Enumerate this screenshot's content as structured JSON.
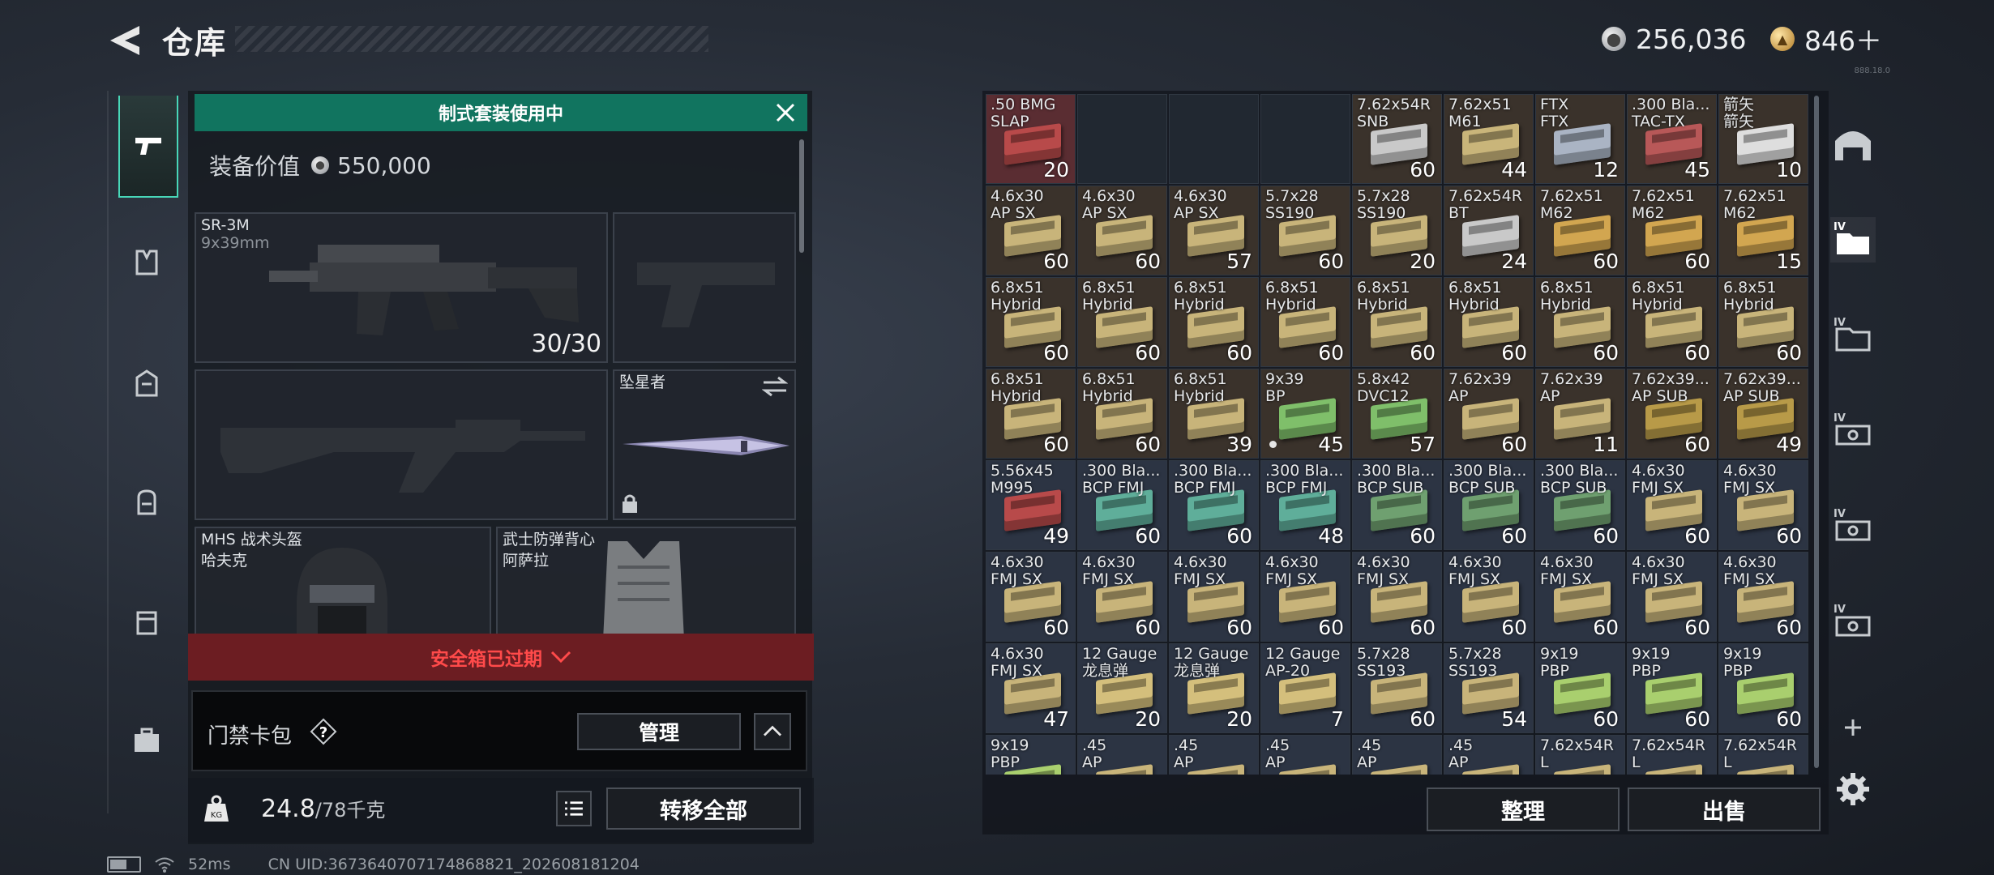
{
  "header": {
    "title": "仓库",
    "currency_silver": "256,036",
    "currency_gold": "846＋",
    "version": "888.18.0"
  },
  "loadout": {
    "banner": "制式套装使用中",
    "value_label": "装备价值",
    "value": "550,000",
    "primary": {
      "name": "SR-3M",
      "caliber": "9x39mm",
      "ammo": "30/30"
    },
    "melee": {
      "name": "坠星者"
    },
    "helmet": {
      "line1": "MHS 战术头盔",
      "line2": "哈夫克"
    },
    "vest": {
      "line1": "武士防弹背心",
      "line2": "阿萨拉"
    },
    "expired": "安全箱已过期",
    "keybag": "门禁卡包",
    "manage": "管理",
    "weight": "24.8",
    "weight_cap": "/78千克",
    "transfer_all": "转移全部"
  },
  "storage": {
    "cells": [
      {
        "name": ".50 BMG\nSLAP",
        "count": "20",
        "bg": "red",
        "box": "#b84a4a"
      },
      {
        "name": "",
        "count": "",
        "bg": "empty"
      },
      {
        "name": "",
        "count": "",
        "bg": "empty"
      },
      {
        "name": "",
        "count": "",
        "bg": "empty"
      },
      {
        "name": "7.62x54R\nSNB",
        "count": "60",
        "bg": "brown",
        "box": "#c9c9c9"
      },
      {
        "name": "7.62x51\nM61",
        "count": "44",
        "bg": "brown",
        "box": "#c9b57a"
      },
      {
        "name": "FTX\nFTX",
        "count": "12",
        "bg": "brown",
        "box": "#aab4c4"
      },
      {
        "name": ".300 Bla...\nTAC-TX",
        "count": "45",
        "bg": "brown",
        "box": "#b85858"
      },
      {
        "name": "箭矢\n箭矢",
        "count": "10",
        "bg": "brown",
        "box": "#dedede"
      },
      {
        "name": "4.6x30\nAP SX",
        "count": "60",
        "bg": "brown",
        "box": "#c8b47a"
      },
      {
        "name": "4.6x30\nAP SX",
        "count": "60",
        "bg": "brown",
        "box": "#c8b47a"
      },
      {
        "name": "4.6x30\nAP SX",
        "count": "57",
        "bg": "brown",
        "box": "#c8b47a"
      },
      {
        "name": "5.7x28\nSS190",
        "count": "60",
        "bg": "brown",
        "box": "#c8b47a"
      },
      {
        "name": "5.7x28\nSS190",
        "count": "20",
        "bg": "brown",
        "box": "#c8b47a"
      },
      {
        "name": "7.62x54R\nBT",
        "count": "24",
        "bg": "brown",
        "box": "#c9c9c9"
      },
      {
        "name": "7.62x51\nM62",
        "count": "60",
        "bg": "brown",
        "box": "#d2a650"
      },
      {
        "name": "7.62x51\nM62",
        "count": "60",
        "bg": "brown",
        "box": "#d2a650"
      },
      {
        "name": "7.62x51\nM62",
        "count": "15",
        "bg": "brown",
        "box": "#d2a650"
      },
      {
        "name": "6.8x51\nHybrid",
        "count": "60",
        "bg": "brown",
        "box": "#c8b47a"
      },
      {
        "name": "6.8x51\nHybrid",
        "count": "60",
        "bg": "brown",
        "box": "#c8b47a"
      },
      {
        "name": "6.8x51\nHybrid",
        "count": "60",
        "bg": "brown",
        "box": "#c8b47a"
      },
      {
        "name": "6.8x51\nHybrid",
        "count": "60",
        "bg": "brown",
        "box": "#c8b47a"
      },
      {
        "name": "6.8x51\nHybrid",
        "count": "60",
        "bg": "brown",
        "box": "#c8b47a"
      },
      {
        "name": "6.8x51\nHybrid",
        "count": "60",
        "bg": "brown",
        "box": "#c8b47a"
      },
      {
        "name": "6.8x51\nHybrid",
        "count": "60",
        "bg": "brown",
        "box": "#c8b47a"
      },
      {
        "name": "6.8x51\nHybrid",
        "count": "60",
        "bg": "brown",
        "box": "#c8b47a"
      },
      {
        "name": "6.8x51\nHybrid",
        "count": "60",
        "bg": "brown",
        "box": "#c8b47a"
      },
      {
        "name": "6.8x51\nHybrid",
        "count": "60",
        "bg": "brown",
        "box": "#c8b47a"
      },
      {
        "name": "6.8x51\nHybrid",
        "count": "60",
        "bg": "brown",
        "box": "#c8b47a"
      },
      {
        "name": "6.8x51\nHybrid",
        "count": "39",
        "bg": "brown",
        "box": "#c8b47a"
      },
      {
        "name": "9x39\nBP",
        "count": "45",
        "bg": "brown",
        "box": "#7fbf6a",
        "dot": true
      },
      {
        "name": "5.8x42\nDVC12",
        "count": "57",
        "bg": "brown",
        "box": "#7fbf6a"
      },
      {
        "name": "7.62x39\nAP",
        "count": "60",
        "bg": "brown",
        "box": "#c8b47a"
      },
      {
        "name": "7.62x39\nAP",
        "count": "11",
        "bg": "brown",
        "box": "#c8b47a"
      },
      {
        "name": "7.62x39...\nAP SUB",
        "count": "60",
        "bg": "brown",
        "box": "#b89a48"
      },
      {
        "name": "7.62x39...\nAP SUB",
        "count": "49",
        "bg": "brown",
        "box": "#b89a48"
      },
      {
        "name": "5.56x45\nM995",
        "count": "49",
        "bg": "blue",
        "box": "#b84a4a"
      },
      {
        "name": ".300 Bla...\nBCP FMJ",
        "count": "60",
        "bg": "blue",
        "box": "#5fae9a"
      },
      {
        "name": ".300 Bla...\nBCP FMJ",
        "count": "60",
        "bg": "blue",
        "box": "#5fae9a"
      },
      {
        "name": ".300 Bla...\nBCP FMJ",
        "count": "48",
        "bg": "blue",
        "box": "#5fae9a"
      },
      {
        "name": ".300 Bla...\nBCP SUB",
        "count": "60",
        "bg": "blue",
        "box": "#6fa070"
      },
      {
        "name": ".300 Bla...\nBCP SUB",
        "count": "60",
        "bg": "blue",
        "box": "#6fa070"
      },
      {
        "name": ".300 Bla...\nBCP SUB",
        "count": "60",
        "bg": "blue",
        "box": "#6fa070"
      },
      {
        "name": "4.6x30\nFMJ SX",
        "count": "60",
        "bg": "blue",
        "box": "#c8b47a"
      },
      {
        "name": "4.6x30\nFMJ SX",
        "count": "60",
        "bg": "blue",
        "box": "#c8b47a"
      },
      {
        "name": "4.6x30\nFMJ SX",
        "count": "60",
        "bg": "blue",
        "box": "#c8b47a"
      },
      {
        "name": "4.6x30\nFMJ SX",
        "count": "60",
        "bg": "blue",
        "box": "#c8b47a"
      },
      {
        "name": "4.6x30\nFMJ SX",
        "count": "60",
        "bg": "blue",
        "box": "#c8b47a"
      },
      {
        "name": "4.6x30\nFMJ SX",
        "count": "60",
        "bg": "blue",
        "box": "#c8b47a"
      },
      {
        "name": "4.6x30\nFMJ SX",
        "count": "60",
        "bg": "blue",
        "box": "#c8b47a"
      },
      {
        "name": "4.6x30\nFMJ SX",
        "count": "60",
        "bg": "blue",
        "box": "#c8b47a"
      },
      {
        "name": "4.6x30\nFMJ SX",
        "count": "60",
        "bg": "blue",
        "box": "#c8b47a"
      },
      {
        "name": "4.6x30\nFMJ SX",
        "count": "60",
        "bg": "blue",
        "box": "#c8b47a"
      },
      {
        "name": "4.6x30\nFMJ SX",
        "count": "60",
        "bg": "blue",
        "box": "#c8b47a"
      },
      {
        "name": "4.6x30\nFMJ SX",
        "count": "47",
        "bg": "blue",
        "box": "#c8b47a"
      },
      {
        "name": "12 Gauge\n龙息弹",
        "count": "20",
        "bg": "blue",
        "box": "#d4bf7c"
      },
      {
        "name": "12 Gauge\n龙息弹",
        "count": "20",
        "bg": "blue",
        "box": "#d4bf7c"
      },
      {
        "name": "12 Gauge\nAP-20",
        "count": "7",
        "bg": "blue",
        "box": "#d4bf7c"
      },
      {
        "name": "5.7x28\nSS193",
        "count": "60",
        "bg": "blue",
        "box": "#c8b47a"
      },
      {
        "name": "5.7x28\nSS193",
        "count": "54",
        "bg": "blue",
        "box": "#c8b47a"
      },
      {
        "name": "9x19\nPBP",
        "count": "60",
        "bg": "blue",
        "box": "#a9cf6e"
      },
      {
        "name": "9x19\nPBP",
        "count": "60",
        "bg": "blue",
        "box": "#a9cf6e"
      },
      {
        "name": "9x19\nPBP",
        "count": "60",
        "bg": "blue",
        "box": "#a9cf6e"
      },
      {
        "name": "9x19\nPBP",
        "count": "",
        "bg": "blue",
        "box": "#a9cf6e"
      },
      {
        "name": ".45\nAP",
        "count": "",
        "bg": "blue",
        "box": "#c8b47a"
      },
      {
        "name": ".45\nAP",
        "count": "",
        "bg": "blue",
        "box": "#c8b47a"
      },
      {
        "name": ".45\nAP",
        "count": "",
        "bg": "blue",
        "box": "#c8b47a"
      },
      {
        "name": ".45\nAP",
        "count": "",
        "bg": "blue",
        "box": "#c8b47a"
      },
      {
        "name": ".45\nAP",
        "count": "",
        "bg": "blue",
        "box": "#c8b47a"
      },
      {
        "name": "7.62x54R\nL",
        "count": "",
        "bg": "blue",
        "box": "#c8b47a"
      },
      {
        "name": "7.62x54R\nL",
        "count": "",
        "bg": "blue",
        "box": "#c8b47a"
      },
      {
        "name": "7.62x54R\nL",
        "count": "",
        "bg": "blue",
        "box": "#c8b47a"
      }
    ],
    "sort": "整理",
    "sell": "出售"
  },
  "status": {
    "ping": "52ms",
    "uid": "CN UID:3673640707174868821_202608181204"
  },
  "colors": {
    "accent": "#48d7b8",
    "banner": "#11745f",
    "expired_bg": "#6c1d22",
    "expired_text": "#ff4a4a"
  }
}
